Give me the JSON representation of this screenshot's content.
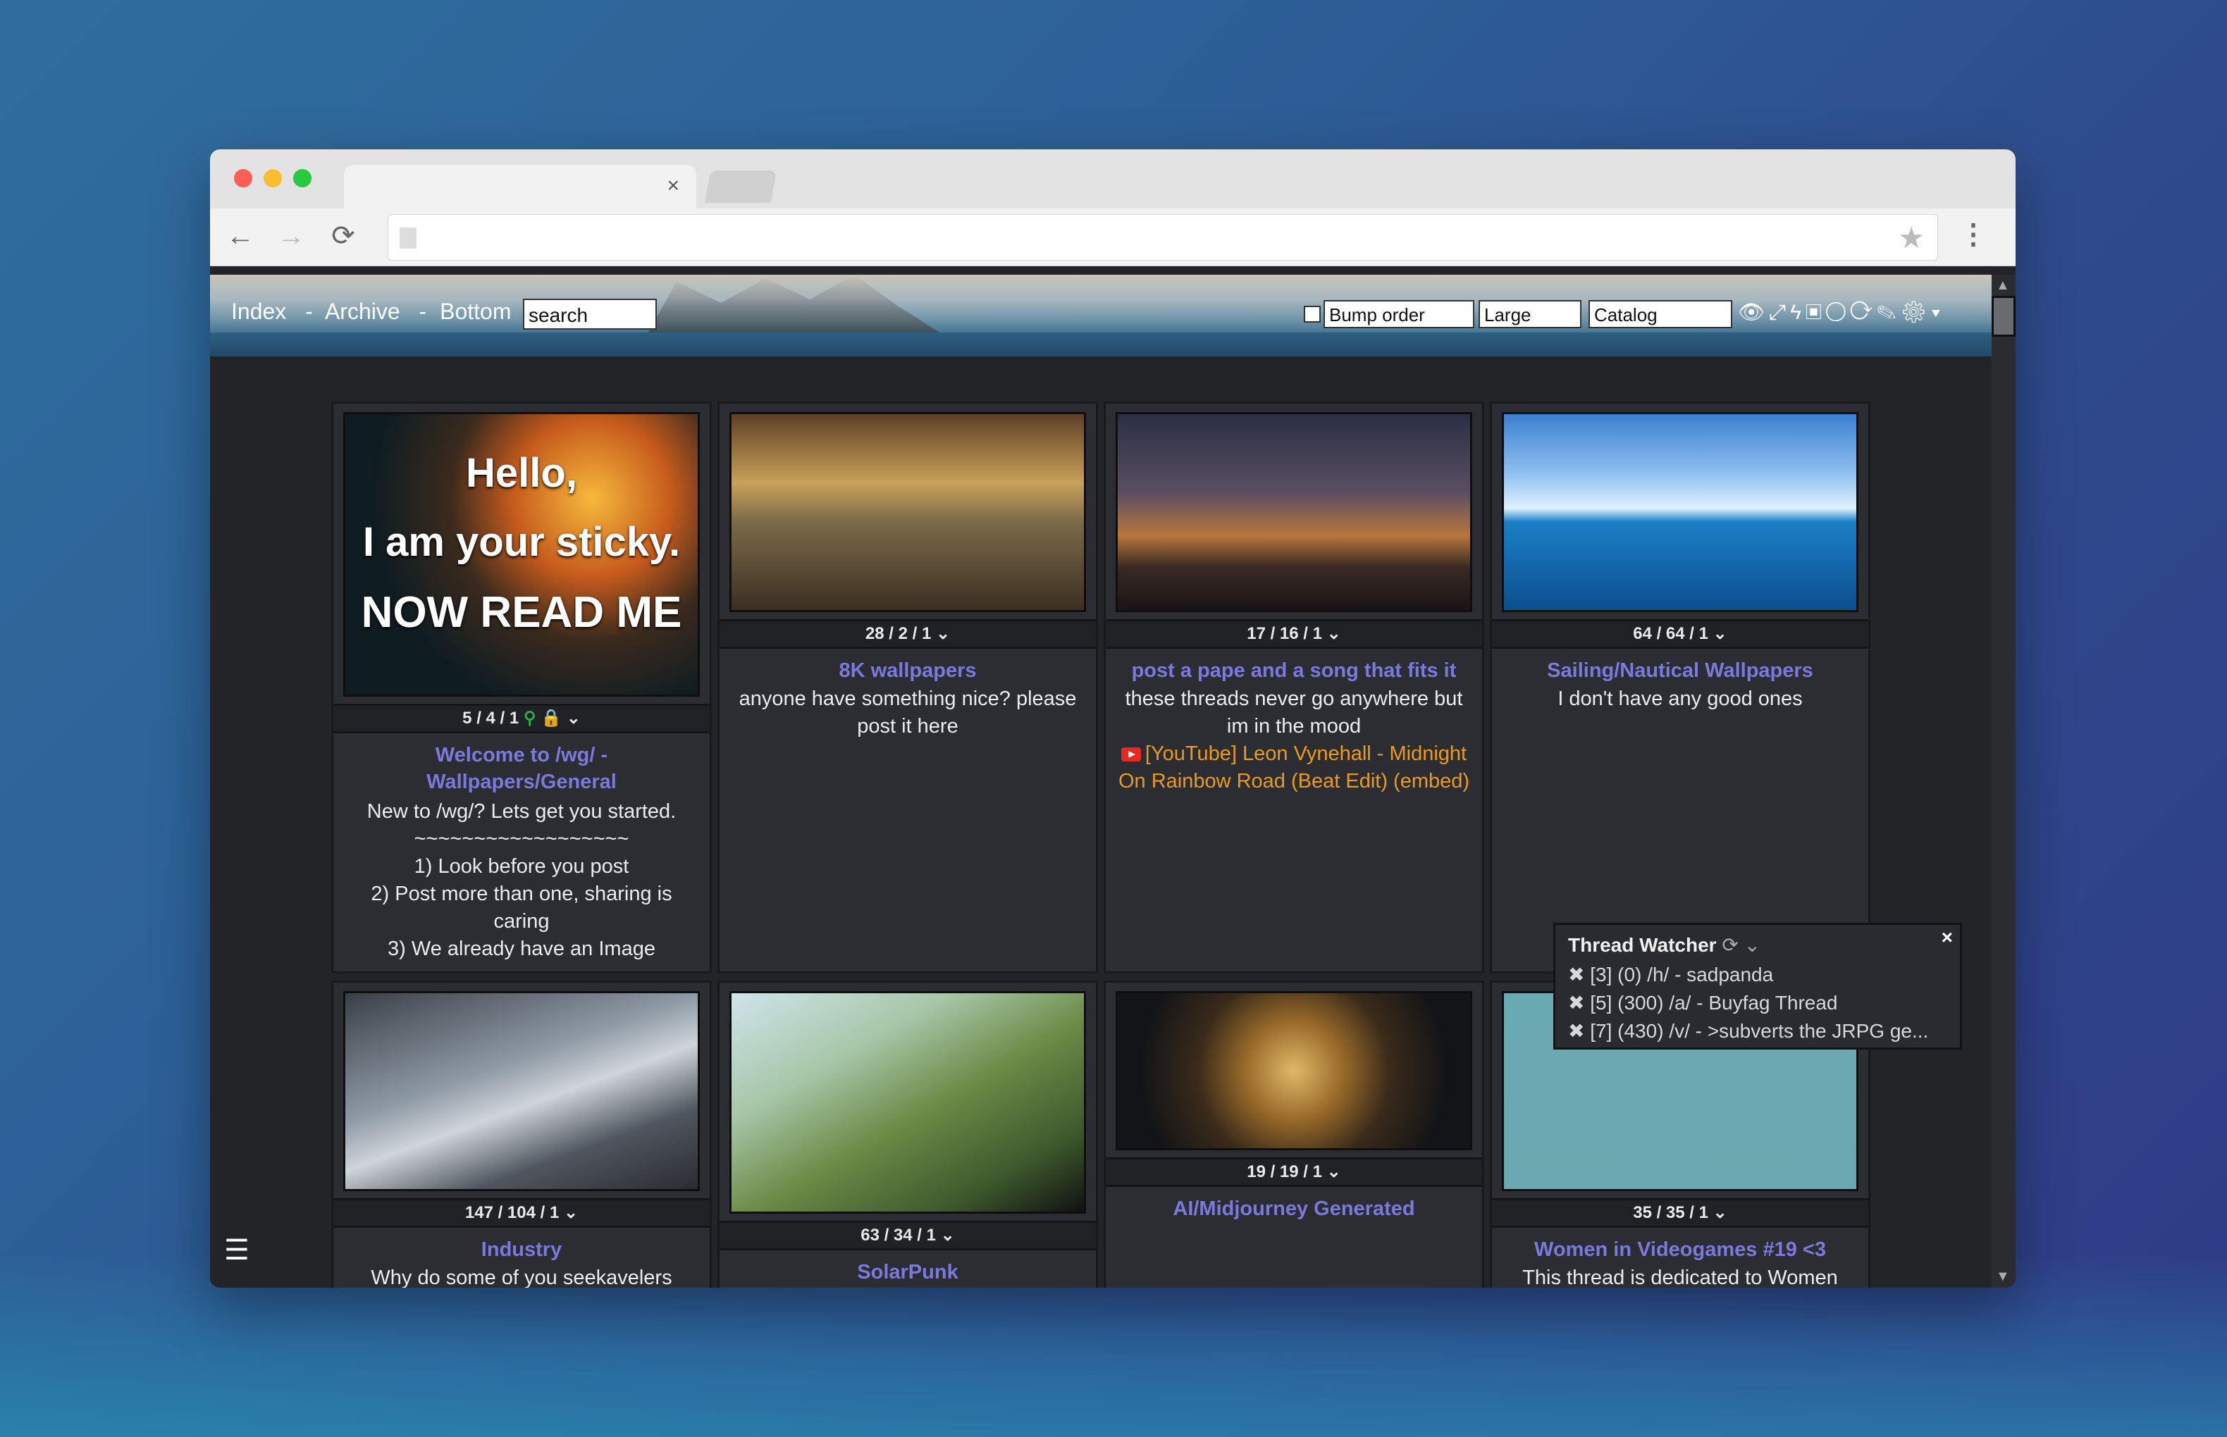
{
  "browser": {
    "tab_close": "×",
    "back_icon": "←",
    "forward_icon": "→",
    "reload_icon": "⟳",
    "star_icon": "★",
    "menu_icon": "⋮"
  },
  "nav": {
    "index": "Index",
    "archive": "Archive",
    "bottom": "Bottom",
    "sep": "-",
    "search_placeholder": "search"
  },
  "controls": {
    "bump_order": "Bump order",
    "size": "Large",
    "mode": "Catalog"
  },
  "cards": [
    {
      "stats": "5 / 4 / 1",
      "title": "Welcome to /wg/ - Wallpapers/General",
      "body": [
        "New to /wg/? Lets get you started.",
        "~~~~~~~~~~~~~~~~~~",
        "1) Look before you post",
        "2) Post more than one, sharing is caring",
        "3) We already have an Image"
      ],
      "sticky": [
        "Hello,",
        "I am your sticky.",
        "NOW READ ME"
      ]
    },
    {
      "stats": "28 / 2 / 1",
      "title": "8K wallpapers",
      "body": [
        "anyone have something nice? please post it here"
      ]
    },
    {
      "stats": "17 / 16 / 1",
      "title": "post a pape and a song that fits it",
      "body": [
        "these threads never go anywhere but im in the mood"
      ],
      "embed": "[YouTube] Leon Vynehall - Midnight On Rainbow Road (Beat Edit) (embed)"
    },
    {
      "stats": "64 / 64 / 1",
      "title": "Sailing/Nautical Wallpapers",
      "body": [
        "I don't have any good ones"
      ]
    },
    {
      "stats": "147 / 104 / 1",
      "title": "Industry",
      "body": [
        "Why do some of you seekavelers"
      ]
    },
    {
      "stats": "63 / 34 / 1",
      "title": "SolarPunk",
      "body": []
    },
    {
      "stats": "19 / 19 / 1",
      "title": "AI/Midjourney Generated",
      "body": []
    },
    {
      "stats": "35 / 35 / 1",
      "title": "Women in Videogames #19 <3",
      "body": [
        "This thread is dedicated to Women"
      ]
    }
  ],
  "watcher": {
    "title": "Thread Watcher",
    "close": "×",
    "rows": [
      "[3] (0) /h/ - sadpanda",
      "[5] (300) /a/ - Buyfag Thread",
      "[7] (430) /v/ - >subverts the JRPG ge..."
    ]
  }
}
